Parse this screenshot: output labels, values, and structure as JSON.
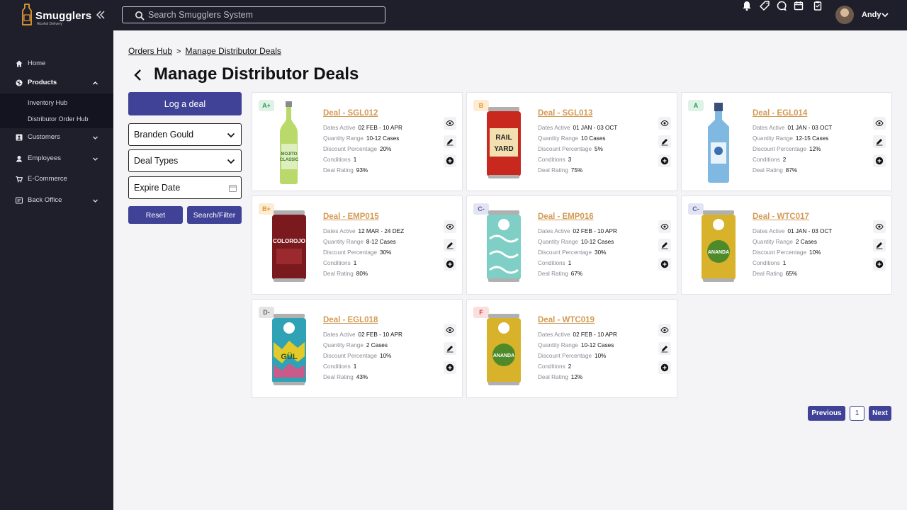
{
  "app": {
    "brand_name": "Smugglers",
    "brand_sub": "Alcohol Delivery",
    "search_placeholder": "Search Smugglers System",
    "user_name": "Andy"
  },
  "sidebar": {
    "items": [
      {
        "label": "Home",
        "icon": "home-icon"
      },
      {
        "label": "Products",
        "icon": "products-icon",
        "expanded": true,
        "children": [
          {
            "label": "Inventory Hub"
          },
          {
            "label": "Distributor Order Hub"
          }
        ]
      },
      {
        "label": "Customers",
        "icon": "customers-icon"
      },
      {
        "label": "Employees",
        "icon": "employees-icon"
      },
      {
        "label": "E-Commerce",
        "icon": "ecommerce-icon"
      },
      {
        "label": "Back Office",
        "icon": "back-office-icon"
      }
    ]
  },
  "breadcrumb": {
    "parent": "Orders Hub",
    "current": "Manage Distributor Deals"
  },
  "page": {
    "title": "Manage Distributor Deals"
  },
  "filters": {
    "log_deal_label": "Log a deal",
    "distributor": "Branden Gould",
    "deal_types": "Deal Types",
    "expire_date": "Expire Date",
    "reset_label": "Reset",
    "search_label": "Search/Filter"
  },
  "labels": {
    "dates_active": "Dates Active",
    "quantity_range": "Quantity Range",
    "discount_percentage": "Discount Percentage",
    "conditions": "Conditions",
    "deal_rating": "Deal Rating"
  },
  "colors": {
    "accent": "#3f4296",
    "deal_link": "#d39a53",
    "background": "#1f1f2b"
  },
  "deals": [
    {
      "grade": "A+",
      "title": "Deal - SGL012",
      "dates": "02 FEB - 10 APR",
      "quantity": "10-12 Cases",
      "discount": "20%",
      "conditions": "1",
      "rating": "93%",
      "product": "lime-bottle",
      "grade_color": "#2f9a55",
      "grade_bg": "#dff2e6"
    },
    {
      "grade": "B",
      "title": "Deal - SGL013",
      "dates": "01 JAN - 03 OCT",
      "quantity": "10 Cases",
      "discount": "5%",
      "conditions": "3",
      "rating": "75%",
      "product": "red-can",
      "grade_color": "#e0952c",
      "grade_bg": "#fdebd3"
    },
    {
      "grade": "A",
      "title": "Deal - EGL014",
      "dates": "01 JAN - 03 OCT",
      "quantity": "12-15 Cases",
      "discount": "12%",
      "conditions": "2",
      "rating": "87%",
      "product": "blue-bottle",
      "grade_color": "#2f9a55",
      "grade_bg": "#dff2e6"
    },
    {
      "grade": "B+",
      "title": "Deal - EMP015",
      "dates": "12 MAR - 24 DEZ",
      "quantity": "8-12 Cases",
      "discount": "30%",
      "conditions": "1",
      "rating": "80%",
      "product": "maroon-can",
      "grade_color": "#e0952c",
      "grade_bg": "#fdebd3"
    },
    {
      "grade": "C-",
      "title": "Deal - EMP016",
      "dates": "02 FEB - 10 APR",
      "quantity": "10-12 Cases",
      "discount": "30%",
      "conditions": "1",
      "rating": "67%",
      "product": "teal-can",
      "grade_color": "#5a5f9a",
      "grade_bg": "#e3e4f3"
    },
    {
      "grade": "C-",
      "title": "Deal - WTC017",
      "dates": "01 JAN - 03 OCT",
      "quantity": "2 Cases",
      "discount": "10%",
      "conditions": "1",
      "rating": "65%",
      "product": "yellow-can",
      "grade_color": "#5a5f9a",
      "grade_bg": "#e3e4f3"
    },
    {
      "grade": "D-",
      "title": "Deal - EGL018",
      "dates": "02 FEB - 10 APR",
      "quantity": "2 Cases",
      "discount": "10%",
      "conditions": "1",
      "rating": "43%",
      "product": "colorful-can",
      "grade_color": "#666666",
      "grade_bg": "#e4e4e4"
    },
    {
      "grade": "F",
      "title": "Deal - WTC019",
      "dates": "02 FEB - 10 APR",
      "quantity": "10-12 Cases",
      "discount": "10%",
      "conditions": "2",
      "rating": "12%",
      "product": "yellow-can",
      "grade_color": "#d23b3b",
      "grade_bg": "#fbdede"
    }
  ],
  "pagination": {
    "previous_label": "Previous",
    "page": "1",
    "next_label": "Next"
  }
}
